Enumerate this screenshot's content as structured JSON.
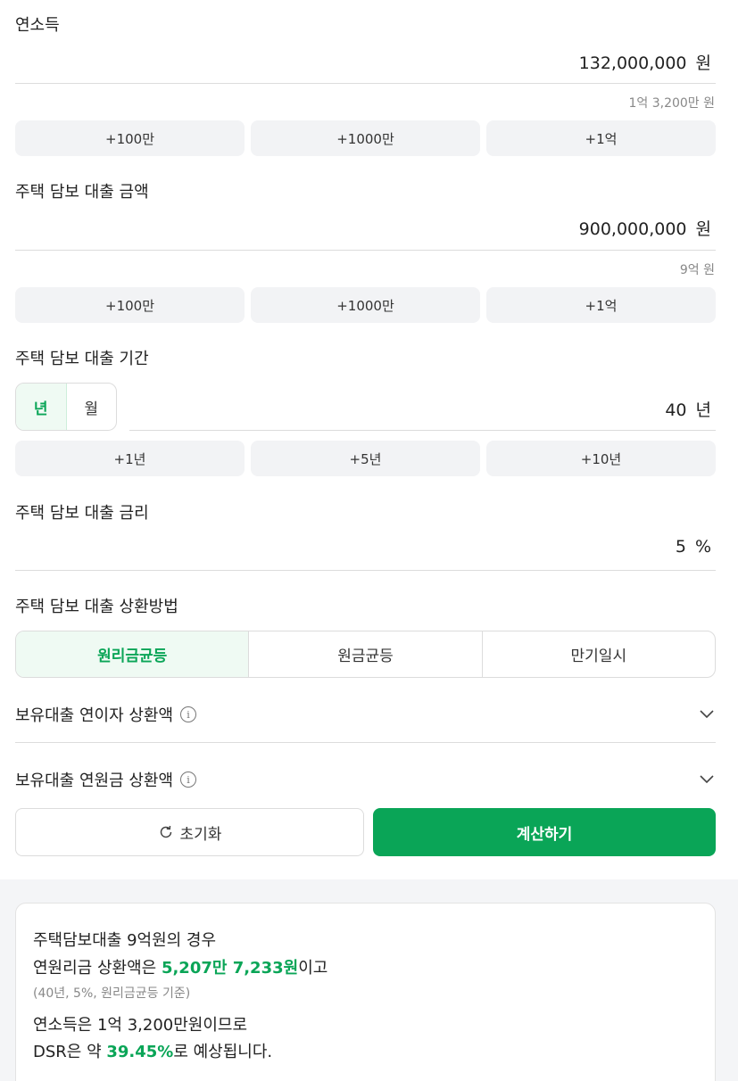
{
  "income": {
    "label": "연소득",
    "value": "132,000,000",
    "unit": "원",
    "korean": "1억 3,200만 원",
    "quick": [
      "+100만",
      "+1000만",
      "+1억"
    ]
  },
  "loan_amount": {
    "label": "주택 담보 대출 금액",
    "value": "900,000,000",
    "unit": "원",
    "korean": "9억 원",
    "quick": [
      "+100만",
      "+1000만",
      "+1억"
    ]
  },
  "loan_term": {
    "label": "주택 담보 대출 기간",
    "toggle": [
      "년",
      "월"
    ],
    "toggle_selected": "년",
    "value": "40",
    "unit": "년",
    "quick": [
      "+1년",
      "+5년",
      "+10년"
    ]
  },
  "interest": {
    "label": "주택 담보 대출 금리",
    "value": "5",
    "unit": "%"
  },
  "repayment": {
    "label": "주택 담보 대출 상환방법",
    "options": [
      "원리금균등",
      "원금균등",
      "만기일시"
    ],
    "selected": "원리금균등"
  },
  "accordions": [
    {
      "label": "보유대출 연이자 상환액",
      "icon": "info-icon"
    },
    {
      "label": "보유대출 연원금 상환액",
      "icon": "info-icon"
    }
  ],
  "actions": {
    "reset_label": "초기화",
    "calc_label": "계산하기"
  },
  "colors": {
    "accent": "#0aa557",
    "accent_bg": "#effaf3"
  },
  "result": {
    "line1": "주택담보대출 9억원의 경우",
    "line2_prefix": "연원리금 상환액은 ",
    "line2_highlight": "5,207만 7,233원",
    "line2_suffix": "이고",
    "note": "(40년, 5%, 원리금균등 기준)",
    "line3": "연소득은 1억 3,200만원이므로",
    "line4_prefix": "DSR은 약 ",
    "line4_highlight": "39.45%",
    "line4_suffix": "로 예상됩니다."
  }
}
